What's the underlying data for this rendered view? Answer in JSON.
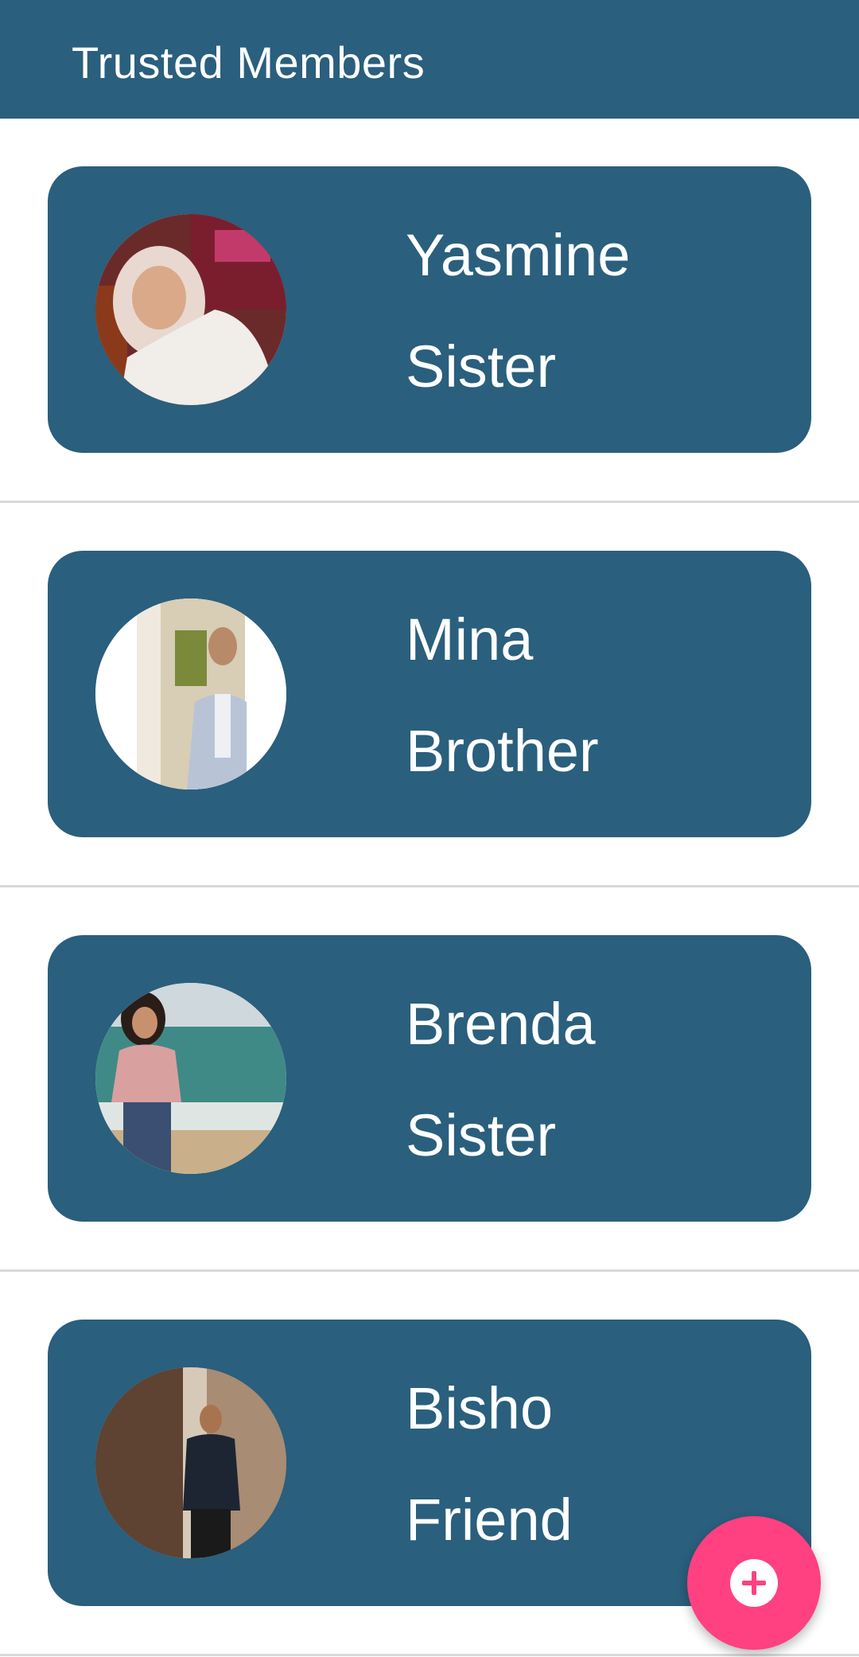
{
  "app_bar": {
    "title": "Trusted Members",
    "background": "#2a5f7d"
  },
  "members": [
    {
      "name": "Yasmine",
      "relation": "Sister"
    },
    {
      "name": "Mina",
      "relation": "Brother"
    },
    {
      "name": "Brenda",
      "relation": "Sister"
    },
    {
      "name": "Bisho",
      "relation": "Friend"
    }
  ],
  "fab": {
    "icon": "add-circle-icon",
    "color": "#ff4081"
  },
  "colors": {
    "card": "#2a5f7d",
    "divider": "#d9d9d9",
    "text": "#ffffff"
  }
}
